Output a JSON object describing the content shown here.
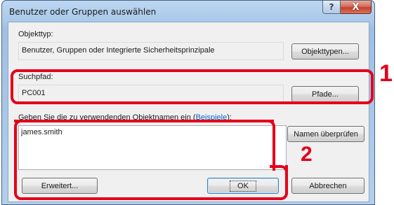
{
  "window": {
    "title": "Benutzer oder Gruppen auswählen",
    "help_glyph": "?",
    "close_glyph": "X"
  },
  "object_type": {
    "label": "Objekttyp:",
    "value": "Benutzer, Gruppen oder Integrierte Sicherheitsprinzipale",
    "button": "Objekttypen..."
  },
  "search_path": {
    "label": "Suchpfad:",
    "value": "PC001",
    "button": "Pfade..."
  },
  "object_names": {
    "label_prefix": "Geben Sie die zu verwendenden Objektnamen ein (",
    "label_link": "Beispiele",
    "label_suffix": "):",
    "value": "james.smith",
    "check_button": "Namen überprüfen"
  },
  "footer": {
    "advanced_button": "Erweitert...",
    "ok_button": "OK",
    "cancel_button": "Abbrechen"
  },
  "callouts": {
    "one": "1",
    "two": "2",
    "color": "#e3001b"
  }
}
